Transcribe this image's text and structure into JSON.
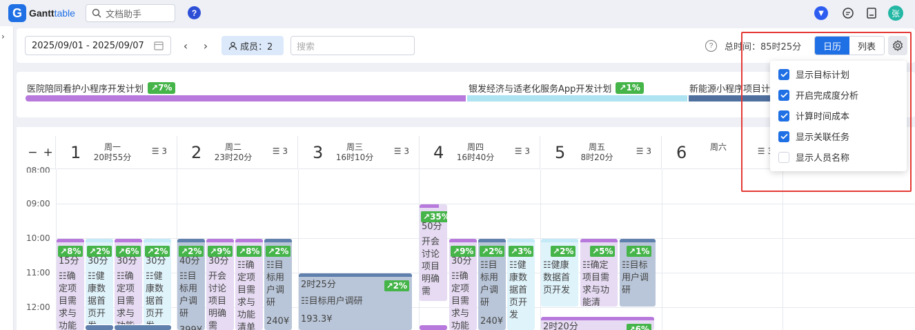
{
  "app": {
    "logo_letter": "G",
    "logo_name_a": "Gantt",
    "logo_name_b": "table",
    "search_placeholder": "文档助手",
    "help": "?",
    "avatar_text": "张"
  },
  "toolbar": {
    "date_range": "2025/09/01 - 2025/09/07",
    "member_label": "成员：2",
    "search_placeholder": "搜索",
    "total_time": "总时间：85时25分",
    "view_calendar": "日历",
    "view_list": "列表"
  },
  "goals": [
    {
      "name": "医院陪同看护小程序开发计划",
      "pct": "7%",
      "color": "#b779dc"
    },
    {
      "name": "银发经济与适老化服务App开发计划",
      "pct": "1%",
      "color": "#aee3f2"
    },
    {
      "name": "新能源小程序项目计",
      "pct": "",
      "color": "#4f6f9f"
    }
  ],
  "calendar": {
    "zoom_minus": "−",
    "zoom_plus": "+",
    "days": [
      {
        "num": "1",
        "name": "周一",
        "time": "20时55分",
        "count": "3"
      },
      {
        "num": "2",
        "name": "周二",
        "time": "23时20分",
        "count": "3"
      },
      {
        "num": "3",
        "name": "周三",
        "time": "16时10分",
        "count": "3"
      },
      {
        "num": "4",
        "name": "周四",
        "time": "16时40分",
        "count": "3"
      },
      {
        "num": "5",
        "name": "周五",
        "time": "8时20分",
        "count": "3"
      },
      {
        "num": "6",
        "name": "周六",
        "time": "",
        "count": "3"
      }
    ],
    "hours": [
      "08:00",
      "09:00",
      "10:00",
      "11:00",
      "12:00"
    ]
  },
  "events": {
    "e1": {
      "pct": "8%",
      "top": "15分",
      "text": "☷确定项目需求与功能"
    },
    "e2": {
      "pct": "2%",
      "top": "30分",
      "text": "☷健康数据首页开发"
    },
    "e3": {
      "pct": "6%",
      "top": "30分",
      "text": "☷确定项目需求与功能"
    },
    "e4": {
      "pct": "2%",
      "top": "30分",
      "text": "☷健康数据首页开发"
    },
    "e5": {
      "pct": "2%",
      "top": "40分",
      "text": "☷目标用户调研",
      "cost": "399¥"
    },
    "e6": {
      "pct": "9%",
      "top": "30分",
      "text": "开会讨论项目明确需"
    },
    "e7": {
      "pct": "8%",
      "text": "☷确定项目需求与功能清单"
    },
    "e8": {
      "pct": "2%",
      "text": "☷目标用户调研",
      "cost": "240¥"
    },
    "e9": {
      "pct": "2%",
      "top": "2时25分",
      "text": "☷目标用户调研",
      "cost": "193.3¥"
    },
    "e10": {
      "pct": "35%",
      "top": "50分",
      "text": "开会讨论项目明确需"
    },
    "e11": {
      "pct": "9%",
      "top": "30分",
      "text": "☷确定项目需求与功能"
    },
    "e12": {
      "pct": "2%",
      "text": "☷目标用户调研",
      "cost": "240¥"
    },
    "e13": {
      "pct": "3%",
      "text": "☷健康数据首页开发"
    },
    "e14": {
      "pct": "2%",
      "text": "☷健康数据首页开发"
    },
    "e15": {
      "pct": "5%",
      "text": "☷确定项目需求与功能清"
    },
    "e16": {
      "pct": "1%",
      "text": "☷目标用户调研"
    },
    "e17": {
      "pct": "6%",
      "top": "2时20分"
    }
  },
  "settings": {
    "options": [
      {
        "label": "显示目标计划",
        "checked": true
      },
      {
        "label": "开启完成度分析",
        "checked": true
      },
      {
        "label": "计算时间成本",
        "checked": true
      },
      {
        "label": "显示关联任务",
        "checked": true
      },
      {
        "label": "显示人员名称",
        "checked": false
      }
    ]
  },
  "colors": {
    "accent": "#1f6fe5",
    "success": "#45b449",
    "highlight": "#e53935"
  }
}
